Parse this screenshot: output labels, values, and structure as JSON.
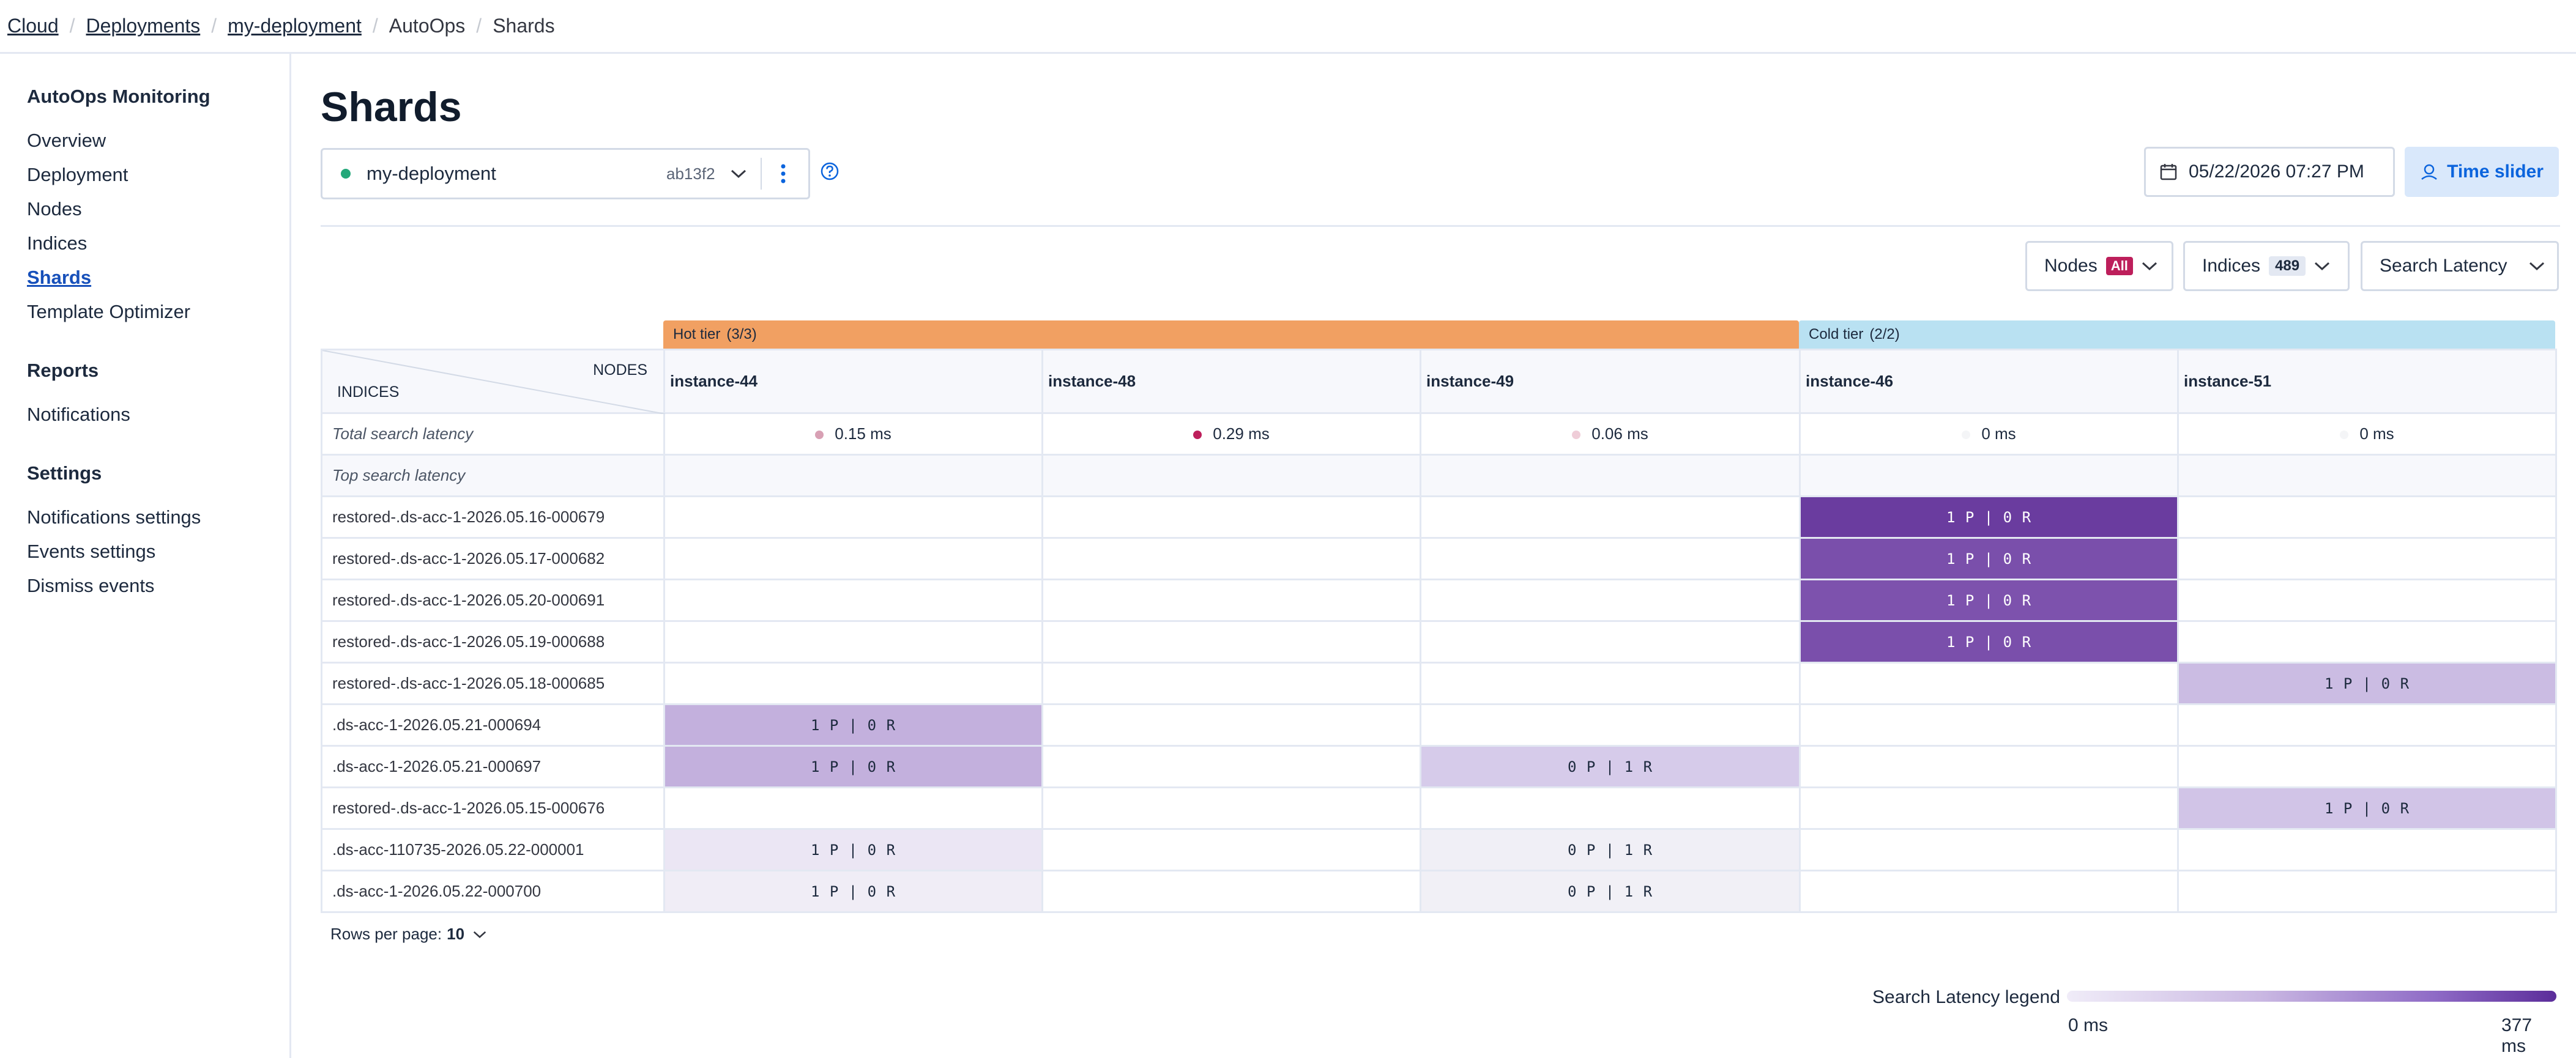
{
  "breadcrumbs": [
    {
      "label": "Cloud",
      "link": true
    },
    {
      "label": "Deployments",
      "link": true
    },
    {
      "label": "my-deployment",
      "link": true
    },
    {
      "label": "AutoOps",
      "link": false
    },
    {
      "label": "Shards",
      "link": false
    }
  ],
  "sidebar": {
    "groups": [
      {
        "title": "AutoOps Monitoring",
        "items": [
          {
            "label": "Overview",
            "active": false
          },
          {
            "label": "Deployment",
            "active": false
          },
          {
            "label": "Nodes",
            "active": false
          },
          {
            "label": "Indices",
            "active": false
          },
          {
            "label": "Shards",
            "active": true
          },
          {
            "label": "Template Optimizer",
            "active": false
          }
        ]
      },
      {
        "title": "Reports",
        "items": [
          {
            "label": "Notifications",
            "active": false
          }
        ]
      },
      {
        "title": "Settings",
        "items": [
          {
            "label": "Notifications settings",
            "active": false
          },
          {
            "label": "Events settings",
            "active": false
          },
          {
            "label": "Dismiss events",
            "active": false
          }
        ]
      }
    ]
  },
  "page": {
    "title": "Shards"
  },
  "deployment_picker": {
    "name": "my-deployment",
    "id": "ab13f2",
    "status_color": "#24a87a"
  },
  "date_picker": {
    "value": "05/22/2026 07:27 PM"
  },
  "time_slider": {
    "label": "Time slider"
  },
  "filters": {
    "nodes": {
      "label": "Nodes",
      "badge": "All"
    },
    "indices": {
      "label": "Indices",
      "badge": "489"
    },
    "metric": {
      "label": "Search Latency"
    }
  },
  "table": {
    "tiers": [
      {
        "label": "Hot tier",
        "count": "(3/3)",
        "color": "#f1a062"
      },
      {
        "label": "Cold tier",
        "count": "(2/2)",
        "color": "#b9e1f2"
      }
    ],
    "corner": {
      "nodes_label": "NODES",
      "indices_label": "INDICES"
    },
    "nodes": [
      "instance-44",
      "instance-48",
      "instance-49",
      "instance-46",
      "instance-51"
    ],
    "total_latency": {
      "label": "Total search latency",
      "values": [
        "0.15 ms",
        "0.29 ms",
        "0.06 ms",
        "0 ms",
        "0 ms"
      ],
      "dot_colors": [
        "#d8a0b4",
        "#bd1f5b",
        "#efcdd8",
        "#f4f5f7",
        "#f4f5f7"
      ]
    },
    "top_latency": {
      "label": "Top search latency"
    },
    "rows": [
      {
        "index": "restored-.ds-acc-1-2026.05.16-000679",
        "cells": [
          "",
          "",
          "",
          "1 P | 0 R",
          ""
        ],
        "colors": [
          "",
          "",
          "",
          "#6a3c9f",
          ""
        ]
      },
      {
        "index": "restored-.ds-acc-1-2026.05.17-000682",
        "cells": [
          "",
          "",
          "",
          "1 P | 0 R",
          ""
        ],
        "colors": [
          "",
          "",
          "",
          "#7a4fab",
          ""
        ]
      },
      {
        "index": "restored-.ds-acc-1-2026.05.20-000691",
        "cells": [
          "",
          "",
          "",
          "1 P | 0 R",
          ""
        ],
        "colors": [
          "",
          "",
          "",
          "#7d52ad",
          ""
        ]
      },
      {
        "index": "restored-.ds-acc-1-2026.05.19-000688",
        "cells": [
          "",
          "",
          "",
          "1 P | 0 R",
          ""
        ],
        "colors": [
          "",
          "",
          "",
          "#7a4fab",
          ""
        ]
      },
      {
        "index": "restored-.ds-acc-1-2026.05.18-000685",
        "cells": [
          "",
          "",
          "",
          "",
          "1 P | 0 R"
        ],
        "colors": [
          "",
          "",
          "",
          "",
          "#cbbce3"
        ]
      },
      {
        "index": ".ds-acc-1-2026.05.21-000694",
        "cells": [
          "1 P | 0 R",
          "",
          "",
          "",
          ""
        ],
        "colors": [
          "#c3b0dd",
          "",
          "",
          "",
          ""
        ]
      },
      {
        "index": ".ds-acc-1-2026.05.21-000697",
        "cells": [
          "1 P | 0 R",
          "",
          "0 P | 1 R",
          "",
          ""
        ],
        "colors": [
          "#c3b0dd",
          "",
          "#d6cbea",
          "",
          ""
        ]
      },
      {
        "index": "restored-.ds-acc-1-2026.05.15-000676",
        "cells": [
          "",
          "",
          "",
          "",
          "1 P | 0 R"
        ],
        "colors": [
          "",
          "",
          "",
          "",
          "#d1c4e7"
        ]
      },
      {
        "index": ".ds-acc-110735-2026.05.22-000001",
        "cells": [
          "1 P | 0 R",
          "",
          "0 P | 1 R",
          "",
          ""
        ],
        "colors": [
          "#ebe6f4",
          "",
          "#f0eff6",
          "",
          ""
        ]
      },
      {
        "index": ".ds-acc-1-2026.05.22-000700",
        "cells": [
          "1 P | 0 R",
          "",
          "0 P | 1 R",
          "",
          ""
        ],
        "colors": [
          "#f0edf6",
          "",
          "#f1f0f6",
          "",
          ""
        ]
      }
    ]
  },
  "pagination": {
    "label": "Rows per page:",
    "value": "10"
  },
  "legend": {
    "title": "Search Latency legend",
    "min": "0 ms",
    "max": "377 ms"
  }
}
